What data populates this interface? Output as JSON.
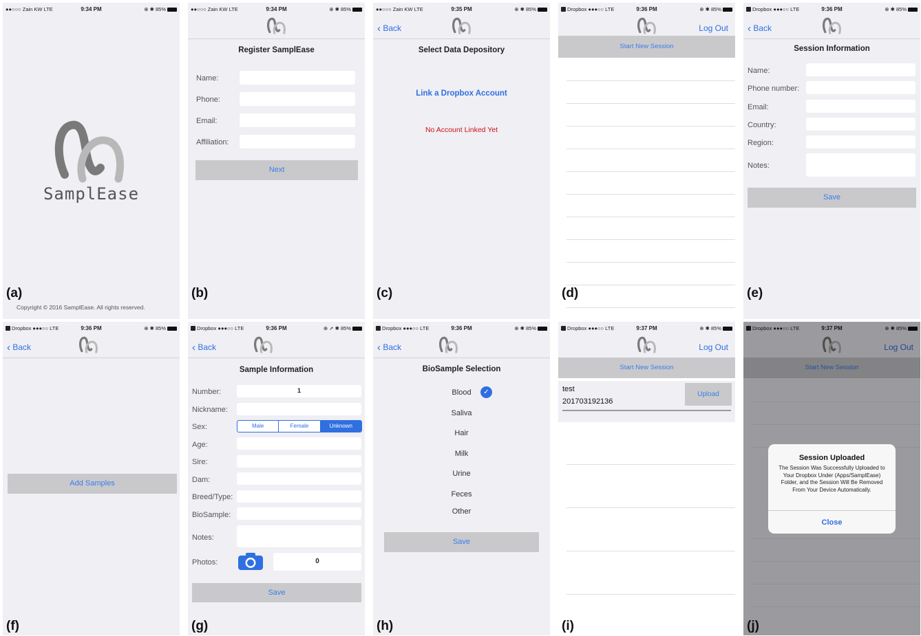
{
  "status": {
    "carrier_a": "●●○○○ Zain KW  LTE",
    "carrier_c": "●●○○○ Zain KW  LTE",
    "carrier_dropbox": "Dropbox ●●●○○  LTE",
    "battery": "85%",
    "status_icons": "⊕ ✱",
    "status_icons_g": "⊕ ➚ ✱",
    "time_a": "9:34 PM",
    "time_b": "9:34 PM",
    "time_c": "9:35 PM",
    "time_d": "9:36 PM",
    "time_e": "9:36 PM",
    "time_f": "9:36 PM",
    "time_g": "9:36 PM",
    "time_h": "9:36 PM",
    "time_i": "9:37 PM",
    "time_j": "9:37 PM"
  },
  "nav": {
    "back": "Back",
    "logout": "Log Out"
  },
  "panel_labels": {
    "a": "(a)",
    "b": "(b)",
    "c": "(c)",
    "d": "(d)",
    "e": "(e)",
    "f": "(f)",
    "g": "(g)",
    "h": "(h)",
    "i": "(i)",
    "j": "(j)"
  },
  "splash": {
    "app_name": "SamplEase",
    "copyright": "Copyright © 2016 SamplEase. All rights reserved."
  },
  "register": {
    "title": "Register SamplEase",
    "fields": [
      "Name:",
      "Phone:",
      "Email:",
      "Affiliation:"
    ],
    "next": "Next"
  },
  "depository": {
    "title": "Select Data Depository",
    "link": "Link a Dropbox Account",
    "status": "No Account Linked Yet"
  },
  "sessions": {
    "start_new": "Start New Session"
  },
  "session_info": {
    "title": "Session Information",
    "fields": [
      "Name:",
      "Phone number:",
      "Email:",
      "Country:",
      "Region:",
      "Notes:"
    ],
    "save": "Save"
  },
  "add_samples": {
    "button": "Add Samples"
  },
  "sample_info": {
    "title": "Sample Information",
    "number_label": "Number:",
    "number_value": "1",
    "nickname": "Nickname:",
    "sex": "Sex:",
    "sex_options": [
      "Male",
      "Female",
      "Unknown"
    ],
    "sex_selected": "Unknown",
    "age": "Age:",
    "sire": "Sire:",
    "dam": "Dam:",
    "breed": "Breed/Type:",
    "biosample": "BioSample:",
    "notes": "Notes:",
    "photos": "Photos:",
    "photos_count": "0",
    "save": "Save"
  },
  "bio_selection": {
    "title": "BioSample Selection",
    "options": [
      "Blood",
      "Saliva",
      "Hair",
      "Milk",
      "Urine",
      "Feces",
      "Other"
    ],
    "selected": "Blood",
    "save": "Save"
  },
  "session_list": {
    "session_name": "test",
    "session_id": "201703192136",
    "upload": "Upload"
  },
  "alert": {
    "title": "Session Uploaded",
    "message": "The Session Was Successfully Uploaded to Your Dropbox Under (Apps/SamplEase) Folder, and the Session Will Be Removed From Your Device Automatically.",
    "close": "Close"
  },
  "colors": {
    "accent": "#2f6fe0",
    "warning": "#cc1111",
    "button_gray": "#c9c9cc",
    "background": "#efeff4"
  }
}
